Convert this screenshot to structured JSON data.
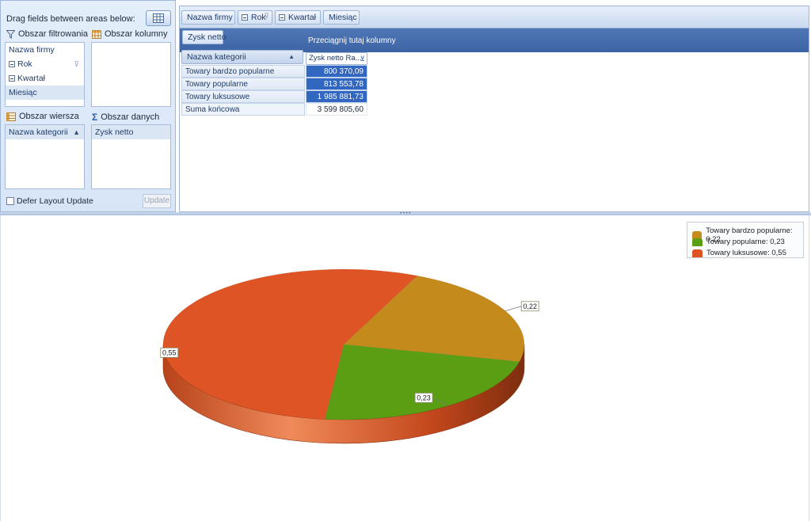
{
  "field_list": {
    "caption": "Drag fields between areas below:",
    "layout_button_icon": "layout-grid-icon",
    "filter_area": {
      "title": "Obszar filtrowania",
      "items": [
        {
          "label": "Nazwa firmy"
        },
        {
          "label": "Rok"
        },
        {
          "label": "Kwartał"
        },
        {
          "label": "Miesiąc"
        }
      ]
    },
    "column_area": {
      "title": "Obszar kolumny",
      "items": []
    },
    "row_area": {
      "title": "Obszar wiersza",
      "items": [
        {
          "label": "Nazwa kategorii"
        }
      ]
    },
    "data_area": {
      "title": "Obszar danych",
      "items": [
        {
          "label": "Zysk netto"
        }
      ]
    },
    "defer_label": "Defer Layout Update",
    "update_button": "Update"
  },
  "pivot": {
    "filter_fields": [
      "Nazwa firmy",
      "Rok",
      "Kwartał",
      "Miesiąc"
    ],
    "data_field": "Zysk netto",
    "column_drop_hint": "Przeciągnij tutaj kolumny",
    "row_field": "Nazwa kategorii",
    "value_header": "Zysk netto Ra...",
    "rows": [
      {
        "label": "Towary bardzo popularne",
        "value": "800 370,09"
      },
      {
        "label": "Towary popularne",
        "value": "813 553,78"
      },
      {
        "label": "Towary luksusowe",
        "value": "1 985 881,73"
      }
    ],
    "total": {
      "label": "Suma końcowa",
      "value": "3 599 805,60"
    }
  },
  "chart_data": {
    "type": "pie",
    "categories": [
      "Towary bardzo popularne",
      "Towary popularne",
      "Towary luksusowe"
    ],
    "values": [
      0.22,
      0.23,
      0.55
    ],
    "data_labels": [
      "0,22",
      "0,23",
      "0,55"
    ],
    "legend": [
      "Towary bardzo popularne: 0,22",
      "Towary popularne: 0,23",
      "Towary luksusowe: 0,55"
    ],
    "legend_position": "top-right",
    "colors": [
      "#c48a1c",
      "#5a9e14",
      "#df5424"
    ],
    "style": "3d"
  }
}
